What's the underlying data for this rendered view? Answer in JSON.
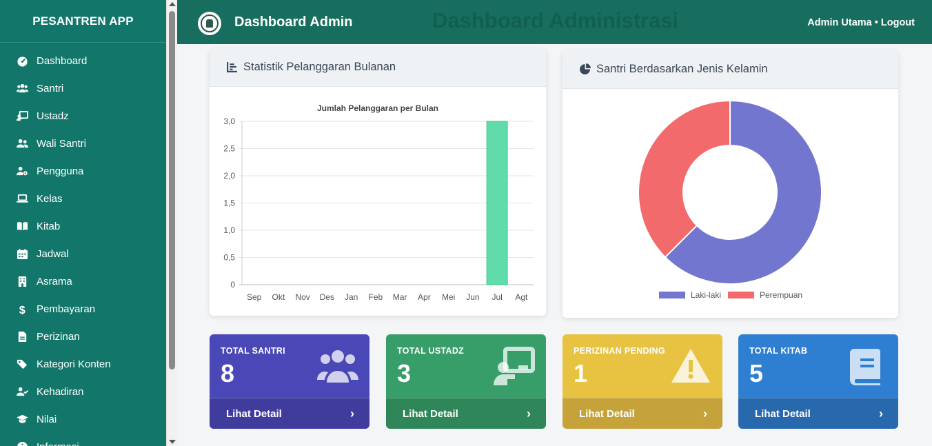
{
  "app": {
    "brand": "PESANTREN APP",
    "title": "Dashboard Admin",
    "ghost_title": "Dashboard Administrasi",
    "user": "Admin Utama • Logout"
  },
  "sidebar": {
    "items": [
      {
        "label": "Dashboard",
        "icon": "tachometer-icon"
      },
      {
        "label": "Santri",
        "icon": "users-icon"
      },
      {
        "label": "Ustadz",
        "icon": "chalkboard-teacher-icon"
      },
      {
        "label": "Wali Santri",
        "icon": "user-friends-icon"
      },
      {
        "label": "Pengguna",
        "icon": "user-cog-icon"
      },
      {
        "label": "Kelas",
        "icon": "laptop-icon"
      },
      {
        "label": "Kitab",
        "icon": "book-open-icon"
      },
      {
        "label": "Jadwal",
        "icon": "calendar-icon"
      },
      {
        "label": "Asrama",
        "icon": "building-icon"
      },
      {
        "label": "Pembayaran",
        "icon": "dollar-icon"
      },
      {
        "label": "Perizinan",
        "icon": "file-icon"
      },
      {
        "label": "Kategori Konten",
        "icon": "tags-icon"
      },
      {
        "label": "Kehadiran",
        "icon": "user-check-icon"
      },
      {
        "label": "Nilai",
        "icon": "graduation-cap-icon"
      },
      {
        "label": "Informasi",
        "icon": "info-circle-icon"
      }
    ]
  },
  "cards": {
    "violations": {
      "title": "Statistik Pelanggaran Bulanan"
    },
    "gender": {
      "title": "Santri Berdasarkan Jenis Kelamin"
    }
  },
  "chart_data": [
    {
      "type": "bar",
      "title": "Jumlah Pelanggaran per Bulan",
      "categories": [
        "Sep",
        "Okt",
        "Nov",
        "Des",
        "Jan",
        "Feb",
        "Mar",
        "Apr",
        "Mei",
        "Jun",
        "Jul",
        "Agt"
      ],
      "values": [
        0,
        0,
        0,
        0,
        0,
        0,
        0,
        0,
        0,
        0,
        3,
        0
      ],
      "yticks": [
        "0",
        "0,5",
        "1,0",
        "1,5",
        "2,0",
        "2,5",
        "3,0"
      ],
      "ylim": [
        0,
        3
      ],
      "grid": true,
      "color": "#5fdcaa"
    },
    {
      "type": "pie",
      "series": [
        {
          "name": "Laki-laki",
          "value": 5,
          "color": "#7376cf"
        },
        {
          "name": "Perempuan",
          "value": 3,
          "color": "#f26a6c"
        }
      ],
      "legend": "bottom"
    }
  ],
  "stats": [
    {
      "label": "TOTAL SANTRI",
      "value": "8",
      "link": "Lihat Detail",
      "icon": "users-icon",
      "color": "#4a47b7",
      "foot_color": "#3f3c9d"
    },
    {
      "label": "TOTAL USTADZ",
      "value": "3",
      "link": "Lihat Detail",
      "icon": "chalkboard-teacher-icon",
      "color": "#379e6a",
      "foot_color": "#2f8759"
    },
    {
      "label": "PERIZINAN PENDING",
      "value": "1",
      "link": "Lihat Detail",
      "icon": "warning-icon",
      "color": "#e8c341",
      "foot_color": "#c5a33a"
    },
    {
      "label": "TOTAL KITAB",
      "value": "5",
      "link": "Lihat Detail",
      "icon": "book-icon",
      "color": "#2e7fd2",
      "foot_color": "#2868ad"
    }
  ]
}
